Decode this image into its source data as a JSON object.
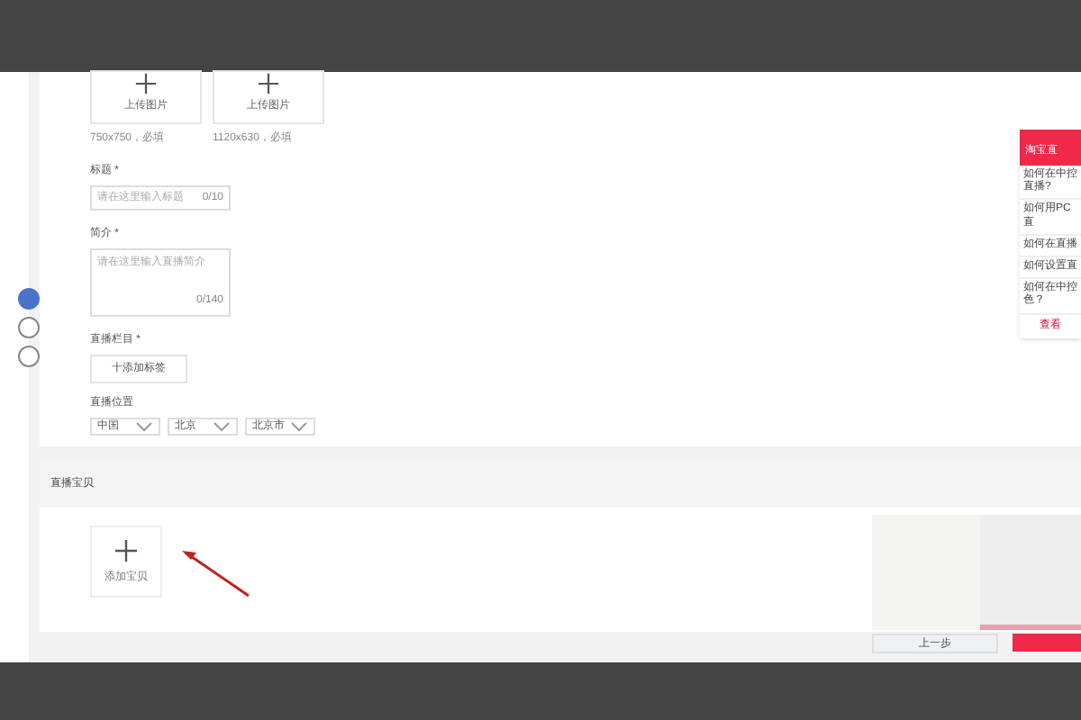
{
  "uploads": [
    {
      "label": "上传图片",
      "hint": "750x750，必填"
    },
    {
      "label": "上传图片",
      "hint": "1120x630，必填"
    }
  ],
  "title_field": {
    "label": "标题 *",
    "placeholder": "请在这里输入标题",
    "counter": "0/10"
  },
  "intro_field": {
    "label": "简介 *",
    "placeholder": "请在这里输入直播简介",
    "counter": "0/140"
  },
  "column_field": {
    "label": "直播栏目 *",
    "button": "十添加标签"
  },
  "location": {
    "label": "直播位置",
    "selects": [
      "中国",
      "北京",
      "北京市"
    ]
  },
  "sidebar": {
    "radios": [
      {
        "selected": true
      },
      {
        "selected": false
      },
      {
        "selected": false
      }
    ]
  },
  "goods": {
    "heading": "直播宝贝",
    "add": "添加宝贝"
  },
  "help_panel": {
    "title": "淘宝直",
    "items": [
      "如何在中控直播?",
      "如何用PC直",
      "如何在直播",
      "如何设置直",
      "如何在中控色？"
    ],
    "more": "查看"
  },
  "footer": {
    "prev": "上一步"
  }
}
